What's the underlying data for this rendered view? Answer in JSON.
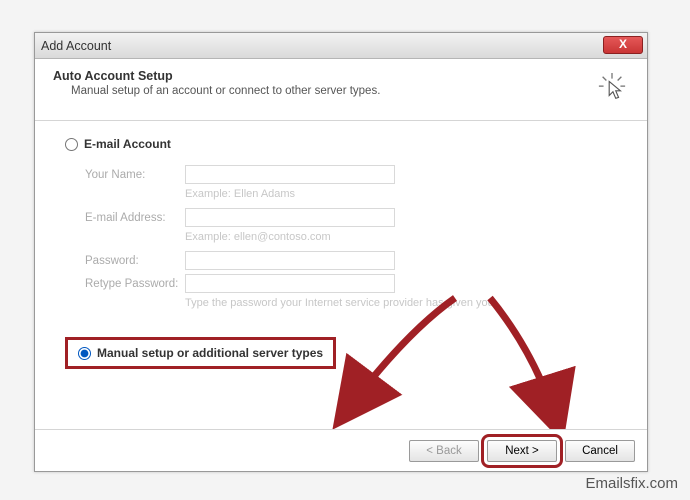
{
  "window": {
    "title": "Add Account"
  },
  "header": {
    "title": "Auto Account Setup",
    "subtitle": "Manual setup of an account or connect to other server types."
  },
  "radio_email": {
    "label": "E-mail Account"
  },
  "form": {
    "name_label": "Your Name:",
    "name_example": "Example: Ellen Adams",
    "email_label": "E-mail Address:",
    "email_example": "Example: ellen@contoso.com",
    "password_label": "Password:",
    "retype_label": "Retype Password:",
    "password_hint": "Type the password your Internet service provider has given you."
  },
  "radio_manual": {
    "label": "Manual setup or additional server types"
  },
  "buttons": {
    "back": "< Back",
    "next": "Next >",
    "cancel": "Cancel"
  },
  "close_glyph": "X",
  "watermark": "Emailsfix.com"
}
